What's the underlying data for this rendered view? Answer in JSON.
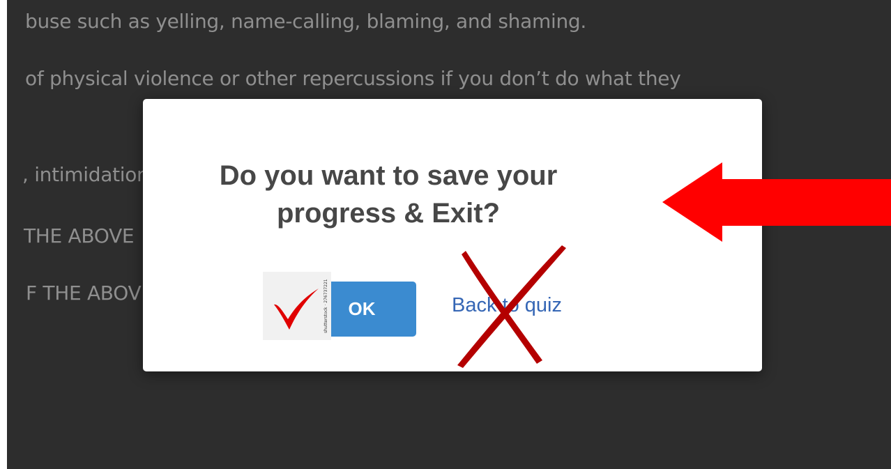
{
  "background": {
    "lines": [
      "buse such as yelling, name-calling, blaming, and shaming.",
      "of physical violence or other repercussions if you don’t do what they",
      ", intimidation",
      "THE ABOVE",
      "F THE ABOVE"
    ]
  },
  "dialog": {
    "title": "Do you want to save your progress & Exit?",
    "ok_label": "OK",
    "back_label": "Back to quiz"
  },
  "watermark": "shutterstock · 276737221",
  "colors": {
    "overlay": "#2d2d2d",
    "ok_button": "#3b8bd0",
    "link": "#3566b5",
    "annotation_red": "#ff0000",
    "cross_red": "#b40000"
  }
}
